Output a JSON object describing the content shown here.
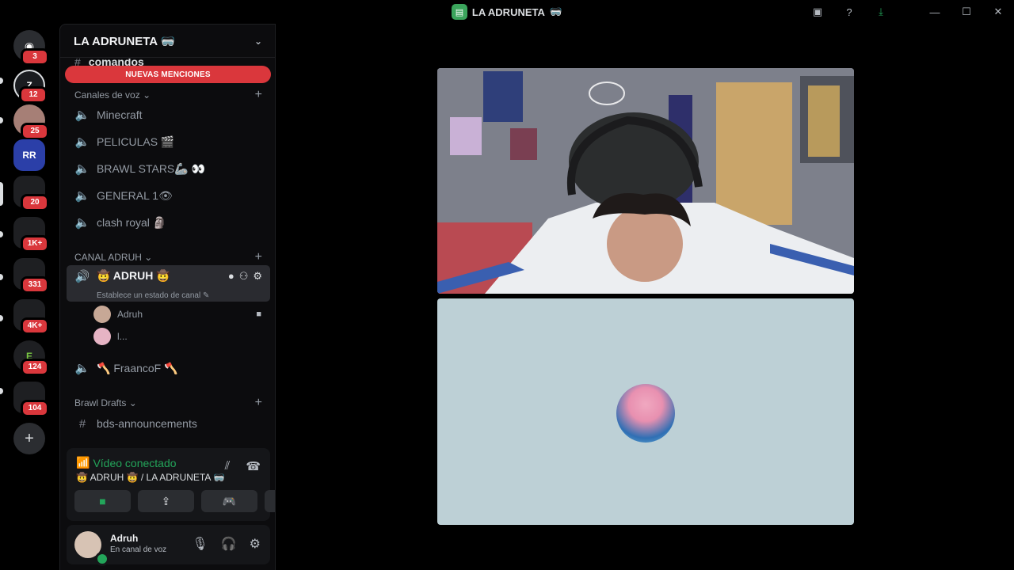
{
  "window": {
    "title": "LA ADRUNETA",
    "title_emoji": "🥽",
    "controls": [
      "minimize",
      "maximize",
      "close"
    ]
  },
  "rail": {
    "servers": [
      {
        "name": "discord-home",
        "label": "",
        "badge": "3"
      },
      {
        "name": "server-z",
        "label": "Z",
        "badge": "12"
      },
      {
        "name": "server-avatar-1",
        "label": "",
        "badge": "25"
      },
      {
        "name": "server-rr-coaching",
        "label": "RR",
        "badge": ""
      },
      {
        "name": "server-folder-1",
        "label": "",
        "badge": "20"
      },
      {
        "name": "server-folder-2",
        "label": "",
        "badge": "1K+"
      },
      {
        "name": "server-folder-3",
        "label": "",
        "badge": "331"
      },
      {
        "name": "server-folder-4",
        "label": "",
        "badge": "4K+"
      },
      {
        "name": "server-e",
        "label": "E",
        "badge": "124"
      },
      {
        "name": "server-folder-5",
        "label": "",
        "badge": "104"
      }
    ],
    "add_label": "+"
  },
  "sidebar": {
    "guild_name": "LA ADRUNETA 🥽",
    "partial_channel": "comandos",
    "mention_bar": "NUEVAS MENCIONES",
    "categories": {
      "voice": "Canales de voz",
      "adruh": "CANAL ADRUH",
      "brawl": "Brawl Drafts"
    },
    "voice_channels": [
      {
        "name": "Minecraft"
      },
      {
        "name": "PELICULAS 🎬"
      },
      {
        "name": "BRAWL STARS🦾 👀"
      },
      {
        "name": "GENERAL 1👁"
      },
      {
        "name": "clash royal 🗿"
      }
    ],
    "active_channel": {
      "name": "🤠 ADRUH 🤠",
      "status": "Establece un estado de canal ✎"
    },
    "voice_users": [
      {
        "name": "Adruh"
      },
      {
        "name": "l..."
      }
    ],
    "other_channel": "🪓 FraancoF 🪓",
    "text_channels": [
      {
        "name": "bds-announcements"
      }
    ]
  },
  "voice_panel": {
    "status": "Vídeo conectado",
    "location": "🤠 ADRUH 🤠 / LA ADRUNETA 🥽",
    "buttons": [
      "camera",
      "screen-share",
      "activity",
      "soundboard"
    ]
  },
  "user_panel": {
    "username": "Adruh",
    "status": "En canal de voz"
  },
  "colors": {
    "accent_green": "#23a55a",
    "mention_red": "#da373c",
    "avatar_tile_bg": "#bdd0d6"
  }
}
